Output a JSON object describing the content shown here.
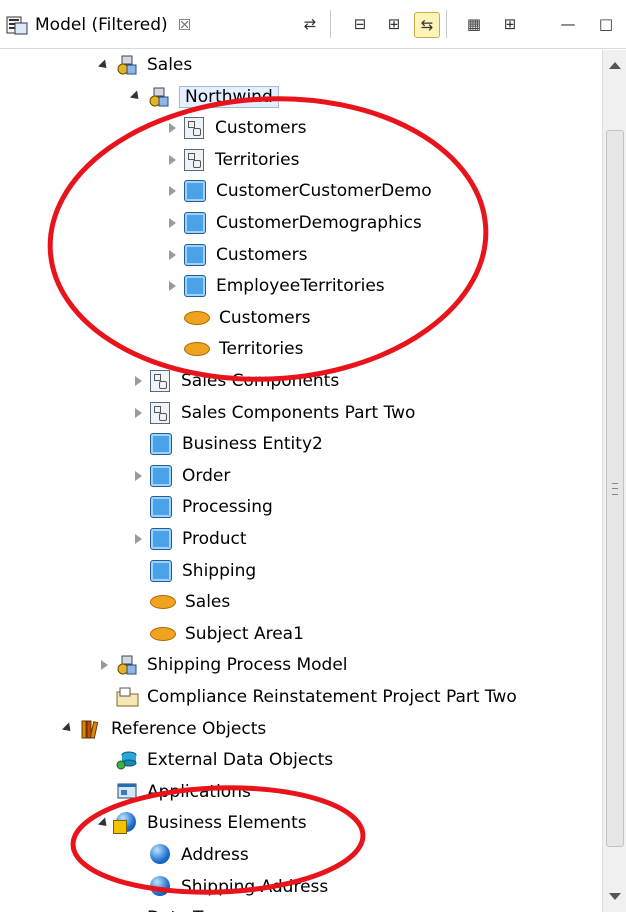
{
  "view": {
    "title": "Model (Filtered)",
    "close_glyph": "☒",
    "icon": "model-view-icon"
  },
  "toolbar": [
    {
      "name": "sync-icon",
      "glyph": "⇄"
    },
    {
      "name": "collapse-all-icon",
      "glyph": "⊟"
    },
    {
      "name": "expand-all-icon",
      "glyph": "⊞"
    },
    {
      "name": "link-with-editor-icon",
      "glyph": "⇆"
    },
    {
      "name": "new-diagram-icon",
      "glyph": "▦"
    },
    {
      "name": "hierarchy-icon",
      "glyph": "⊞"
    },
    {
      "name": "minimize-icon",
      "glyph": "—"
    },
    {
      "name": "maximize-icon",
      "glyph": "□"
    }
  ],
  "tree": [
    {
      "label": "Sales",
      "toggle": "open",
      "icon": "process-model-icon"
    },
    {
      "label": "Northwind",
      "toggle": "open",
      "icon": "process-model-icon",
      "selected": true
    },
    {
      "label": "Customers",
      "toggle": "closed",
      "icon": "diagram-icon"
    },
    {
      "label": "Territories",
      "toggle": "closed",
      "icon": "diagram-icon"
    },
    {
      "label": "CustomerCustomerDemo",
      "toggle": "closed",
      "icon": "entity-icon"
    },
    {
      "label": "CustomerDemographics",
      "toggle": "closed",
      "icon": "entity-icon"
    },
    {
      "label": "Customers",
      "toggle": "closed",
      "icon": "entity-icon"
    },
    {
      "label": "EmployeeTerritories",
      "toggle": "closed",
      "icon": "entity-icon"
    },
    {
      "label": "Customers",
      "toggle": "none",
      "icon": "subject-area-icon"
    },
    {
      "label": "Territories",
      "toggle": "none",
      "icon": "subject-area-icon"
    },
    {
      "label": "Sales Components",
      "toggle": "closed",
      "icon": "diagram-icon"
    },
    {
      "label": "Sales Components Part Two",
      "toggle": "closed",
      "icon": "diagram-icon"
    },
    {
      "label": "Business Entity2",
      "toggle": "none",
      "icon": "entity-icon"
    },
    {
      "label": "Order",
      "toggle": "closed",
      "icon": "entity-icon"
    },
    {
      "label": "Processing",
      "toggle": "none",
      "icon": "entity-icon"
    },
    {
      "label": "Product",
      "toggle": "closed",
      "icon": "entity-icon"
    },
    {
      "label": "Shipping",
      "toggle": "none",
      "icon": "entity-icon"
    },
    {
      "label": "Sales",
      "toggle": "none",
      "icon": "subject-area-icon"
    },
    {
      "label": "Subject Area1",
      "toggle": "none",
      "icon": "subject-area-icon"
    },
    {
      "label": "Shipping Process Model",
      "toggle": "closed",
      "icon": "process-model-icon"
    },
    {
      "label": "Compliance Reinstatement Project Part Two",
      "toggle": "none",
      "icon": "project-folder-icon"
    },
    {
      "label": "Reference Objects",
      "toggle": "open",
      "icon": "books-icon"
    },
    {
      "label": "External Data Objects",
      "toggle": "none",
      "icon": "external-data-icon"
    },
    {
      "label": "Applications",
      "toggle": "none",
      "icon": "applications-icon"
    },
    {
      "label": "Business Elements",
      "toggle": "open",
      "icon": "business-elements-icon"
    },
    {
      "label": "Address",
      "toggle": "none",
      "icon": "globe-icon"
    },
    {
      "label": "Shipping Address",
      "toggle": "none",
      "icon": "globe-icon"
    },
    {
      "label": "Data Types",
      "toggle": "none",
      "icon": "data-types-icon"
    }
  ],
  "annotation_color": "#e8131b"
}
